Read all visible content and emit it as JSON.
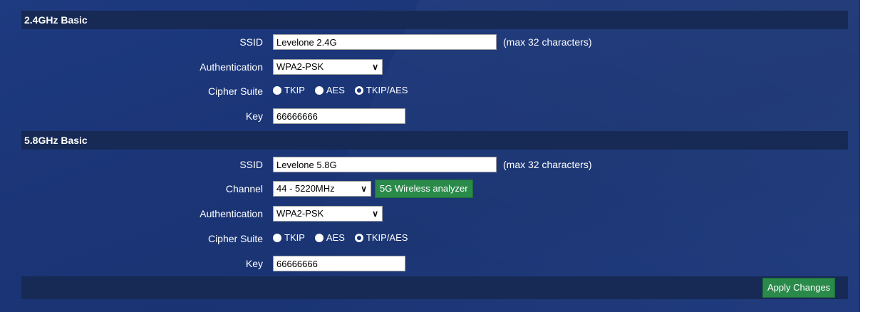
{
  "band24": {
    "title": "2.4GHz Basic",
    "ssid_label": "SSID",
    "ssid_value": "Levelone 2.4G",
    "ssid_hint": "(max 32 characters)",
    "auth_label": "Authentication",
    "auth_value": "WPA2-PSK",
    "cipher_label": "Cipher Suite",
    "cipher_options": [
      "TKIP",
      "AES",
      "TKIP/AES"
    ],
    "cipher_selected": "TKIP/AES",
    "key_label": "Key",
    "key_value": "66666666"
  },
  "band58": {
    "title": "5.8GHz Basic",
    "ssid_label": "SSID",
    "ssid_value": "Levelone 5.8G",
    "ssid_hint": "(max 32 characters)",
    "channel_label": "Channel",
    "channel_value": "44 - 5220MHz",
    "analyzer_label": "5G Wireless analyzer",
    "auth_label": "Authentication",
    "auth_value": "WPA2-PSK",
    "cipher_label": "Cipher Suite",
    "cipher_options": [
      "TKIP",
      "AES",
      "TKIP/AES"
    ],
    "cipher_selected": "TKIP/AES",
    "key_label": "Key",
    "key_value": "66666666"
  },
  "apply_label": "Apply Changes",
  "colors": {
    "panel": "#1b3577",
    "header": "#172a55",
    "button_green": "#2a8a4a"
  }
}
